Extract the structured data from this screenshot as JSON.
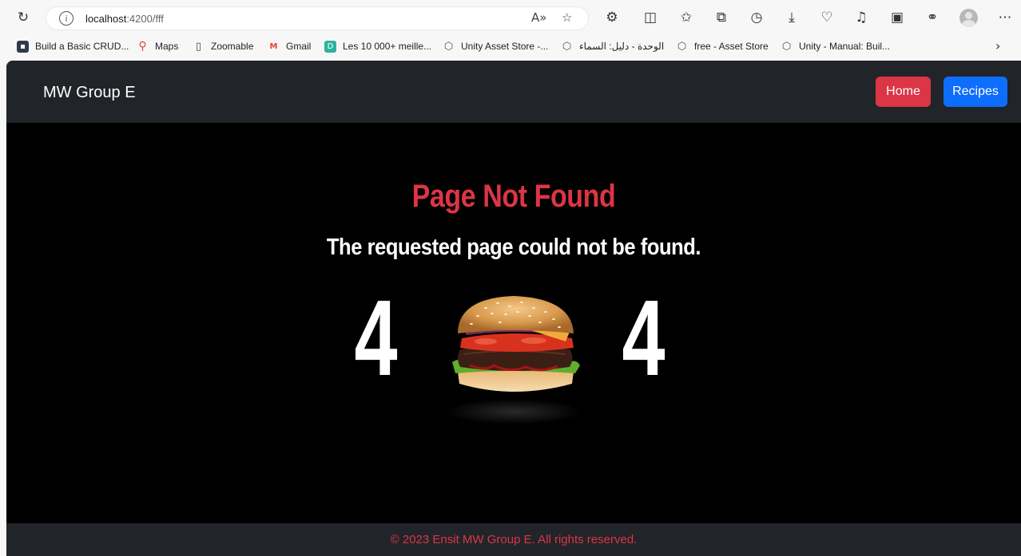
{
  "browser": {
    "url_host": "localhost",
    "url_path": ":4200/fff",
    "bookmarks": [
      {
        "label": "Build a Basic CRUD...",
        "icon": "app-icon",
        "color": "#3b5998"
      },
      {
        "label": "Maps",
        "icon": "maps-pin-icon",
        "color": "#34a853"
      },
      {
        "label": "Zoomable",
        "icon": "document-icon",
        "color": "#555555"
      },
      {
        "label": "Gmail",
        "icon": "gmail-icon",
        "color": "#ea4335"
      },
      {
        "label": "Les 10 000+ meille...",
        "icon": "d-icon",
        "color": "#2bb3a0"
      },
      {
        "label": "Unity Asset Store -...",
        "icon": "unity-icon",
        "color": "#555555"
      },
      {
        "label": "الوحدة - دليل: السماء",
        "icon": "unity-icon",
        "color": "#555555"
      },
      {
        "label": "free - Asset Store",
        "icon": "unity-icon",
        "color": "#555555"
      },
      {
        "label": "Unity - Manual: Buil...",
        "icon": "unity-icon",
        "color": "#555555"
      }
    ]
  },
  "navbar": {
    "brand": "MW Group E",
    "home_label": "Home",
    "recipes_label": "Recipes"
  },
  "content": {
    "title": "Page Not Found",
    "subtitle": "The requested page could not be found.",
    "digit_left": "4",
    "digit_right": "4"
  },
  "footer": {
    "text": "© 2023 Ensit MW Group E. All rights reserved."
  },
  "colors": {
    "accent_red": "#dc3545",
    "accent_blue": "#0d6efd",
    "nav_bg": "#212529"
  }
}
